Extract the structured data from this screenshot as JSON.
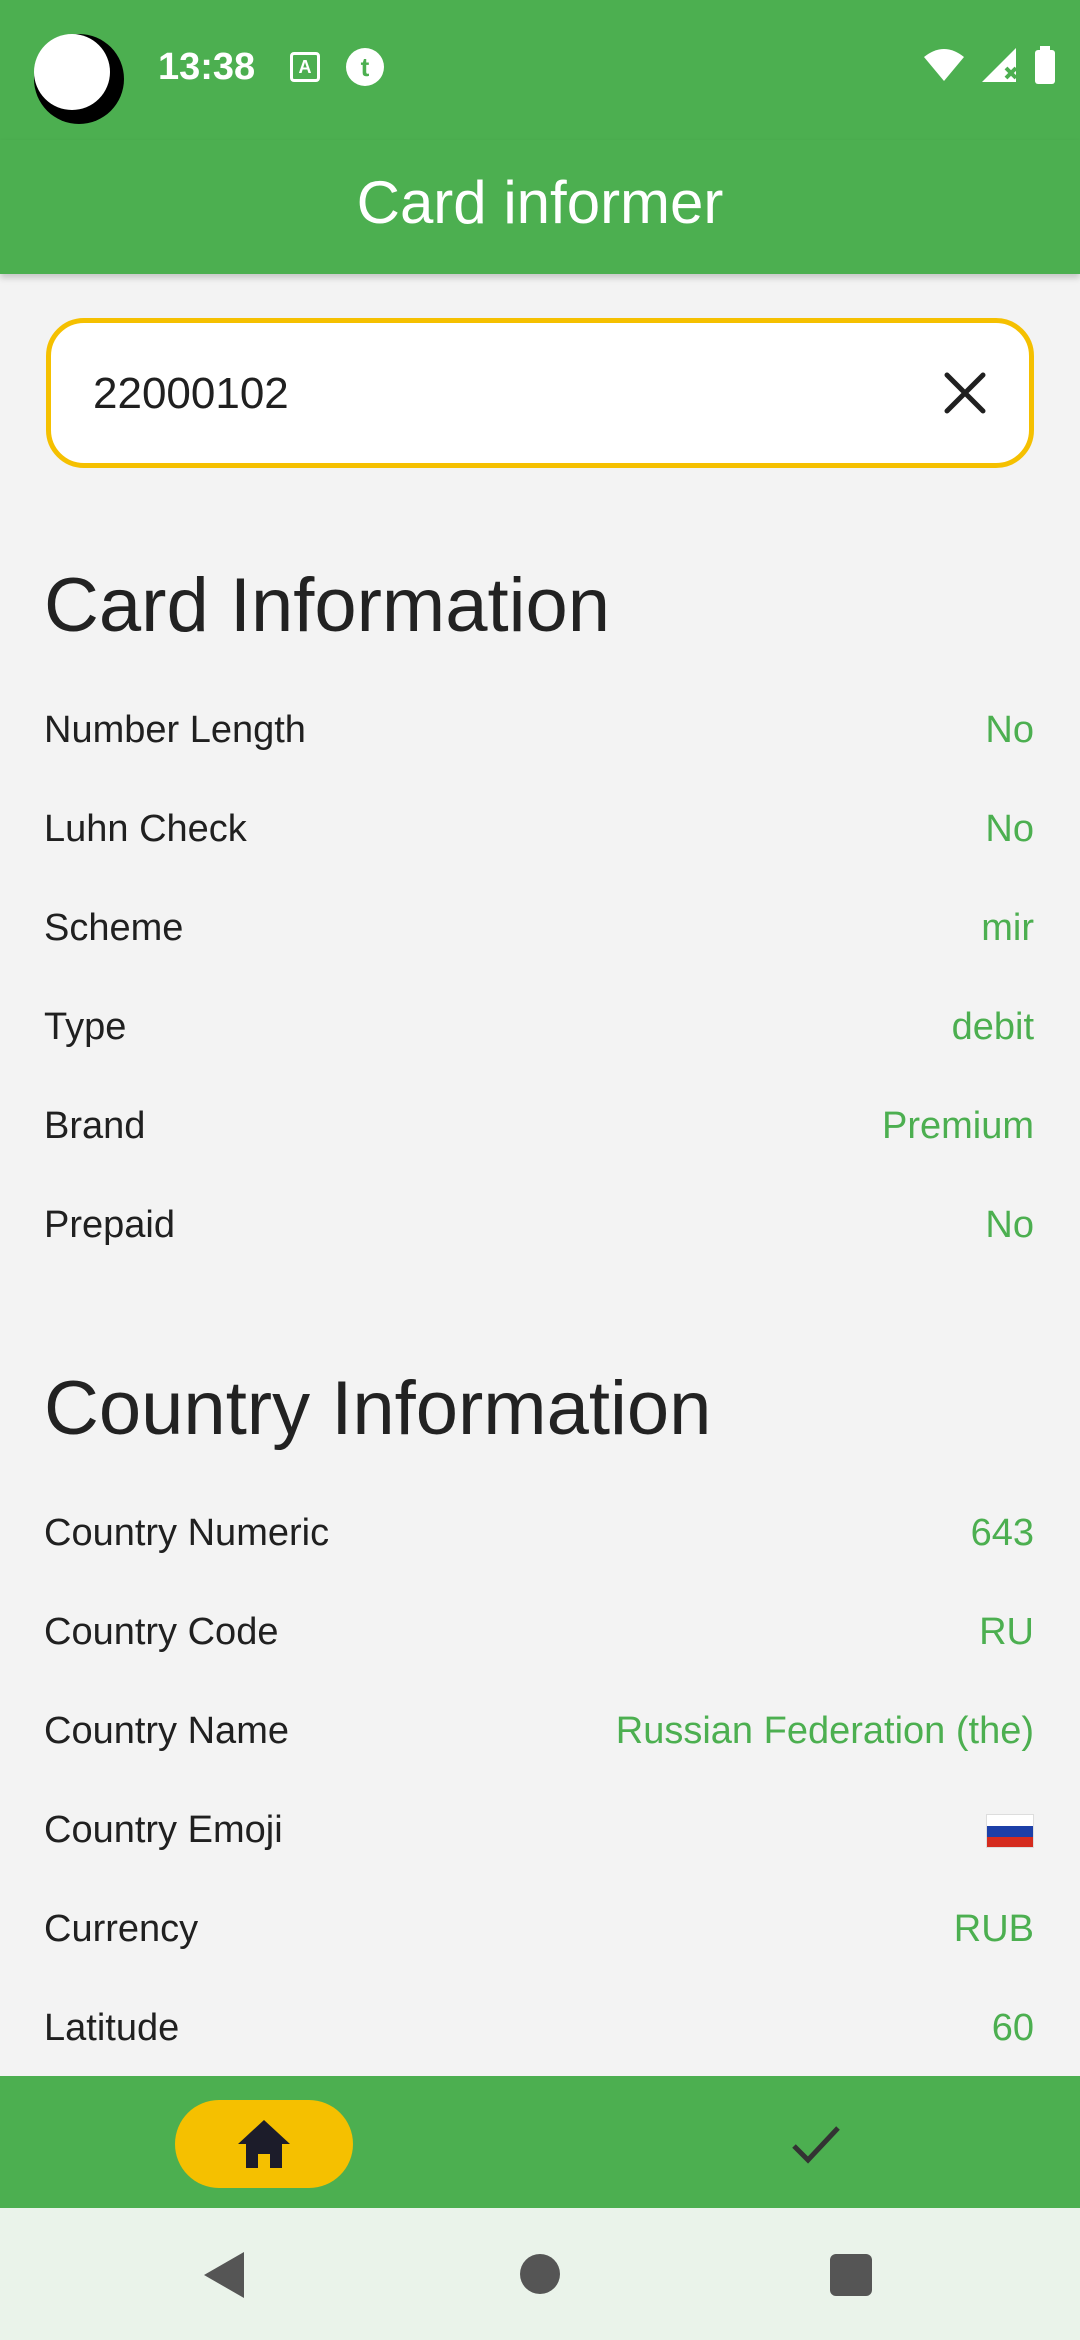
{
  "status_bar": {
    "time": "13:38",
    "icons": [
      "keyboard-a-icon",
      "t-app-icon",
      "wifi-icon",
      "signal-icon",
      "battery-icon"
    ]
  },
  "app_bar": {
    "title": "Card informer"
  },
  "search": {
    "value": "22000102",
    "clear_icon": "close-icon"
  },
  "card_info": {
    "title": "Card Information",
    "rows": [
      {
        "label": "Number Length",
        "value": "No"
      },
      {
        "label": "Luhn Check",
        "value": "No"
      },
      {
        "label": "Scheme",
        "value": "mir"
      },
      {
        "label": "Type",
        "value": "debit"
      },
      {
        "label": "Brand",
        "value": "Premium"
      },
      {
        "label": "Prepaid",
        "value": "No"
      }
    ]
  },
  "country_info": {
    "title": "Country Information",
    "rows": [
      {
        "label": "Country Numeric",
        "value": "643"
      },
      {
        "label": "Country Code",
        "value": "RU"
      },
      {
        "label": "Country Name",
        "value": "Russian Federation (the)"
      },
      {
        "label": "Country Emoji",
        "value": "🇷🇺"
      },
      {
        "label": "Currency",
        "value": "RUB"
      },
      {
        "label": "Latitude",
        "value": "60"
      }
    ]
  },
  "bottom_nav": {
    "items": [
      "home-icon",
      "check-icon"
    ],
    "active": "home-icon"
  },
  "colors": {
    "primary": "#4caf50",
    "accent": "#f5c000",
    "background": "#f3f3f3",
    "value_text": "#4caf50"
  }
}
